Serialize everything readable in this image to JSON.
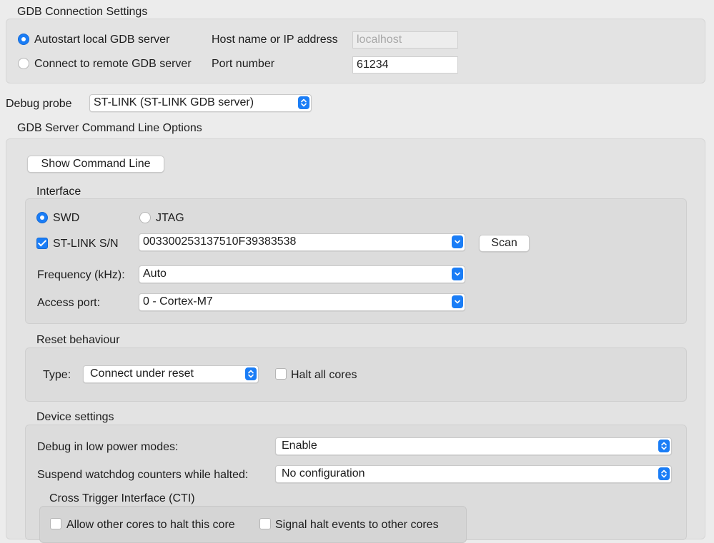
{
  "gdb_connection": {
    "title": "GDB Connection Settings",
    "autostart_label": "Autostart local GDB server",
    "remote_label": "Connect to remote GDB server",
    "host_label": "Host name or IP address",
    "host_value": "localhost",
    "port_label": "Port number",
    "port_value": "61234"
  },
  "debug_probe": {
    "label": "Debug probe",
    "value": "ST-LINK (ST-LINK GDB server)"
  },
  "server_options": {
    "title": "GDB Server Command Line Options",
    "show_command_line": "Show Command Line"
  },
  "interface": {
    "title": "Interface",
    "swd_label": "SWD",
    "jtag_label": "JTAG",
    "stlink_sn_label": "ST-LINK S/N",
    "stlink_sn_value": "003300253137510F39383538",
    "scan_label": "Scan",
    "frequency_label": "Frequency (kHz):",
    "frequency_value": "Auto",
    "access_port_label": "Access port:",
    "access_port_value": "0 - Cortex-M7"
  },
  "reset": {
    "title": "Reset behaviour",
    "type_label": "Type:",
    "type_value": "Connect under reset",
    "halt_all_label": "Halt all cores"
  },
  "device": {
    "title": "Device settings",
    "low_power_label": "Debug in low power modes:",
    "low_power_value": "Enable",
    "watchdog_label": "Suspend watchdog counters while halted:",
    "watchdog_value": "No configuration",
    "cti_title": "Cross Trigger Interface (CTI)",
    "allow_halt_label": "Allow other cores to halt this core",
    "signal_halt_label": "Signal halt events to other cores"
  },
  "colors": {
    "accent": "#1a7df6",
    "window_bg": "#ececec",
    "group_bg": "#e3e3e3"
  }
}
